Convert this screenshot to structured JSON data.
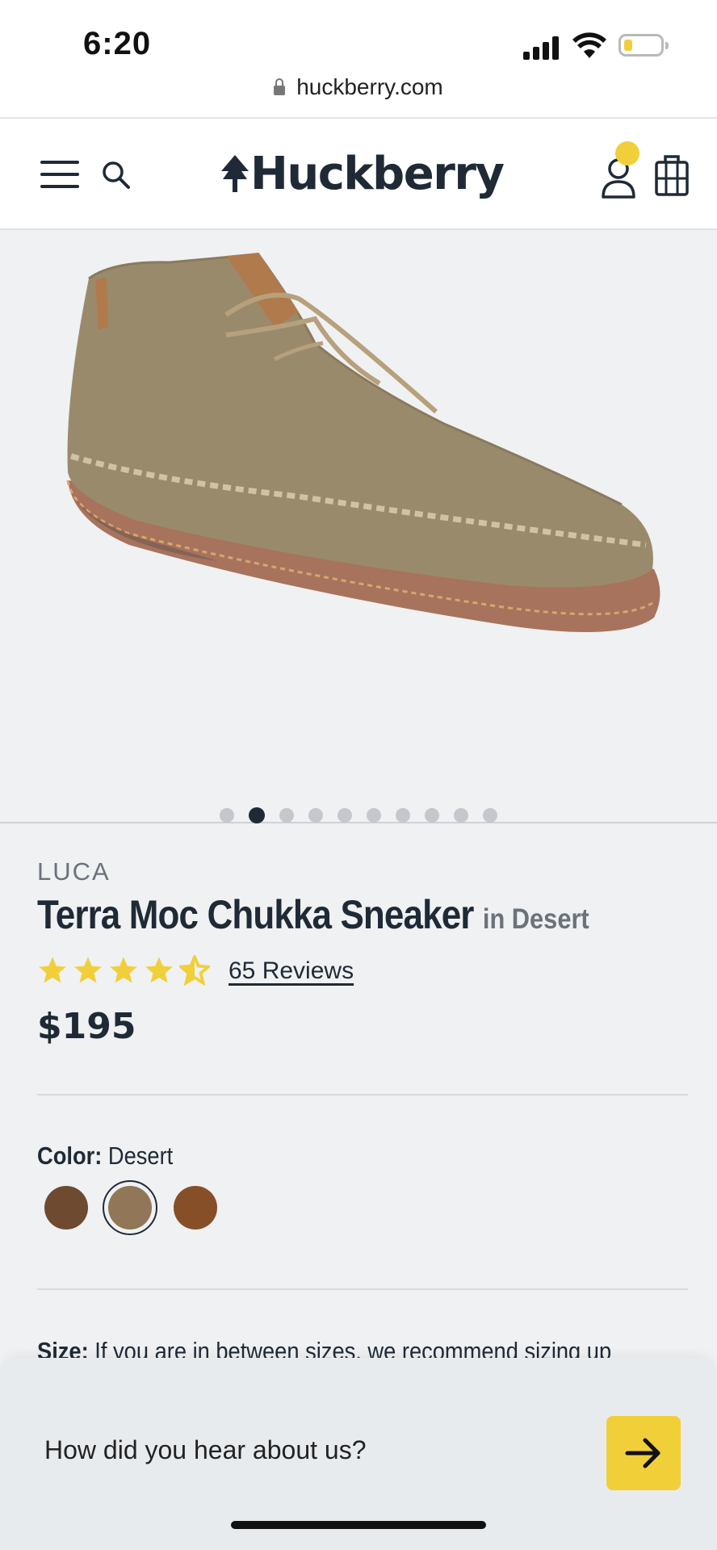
{
  "status_bar": {
    "time": "6:20",
    "url": "huckberry.com"
  },
  "header": {
    "logo": "Huckberry",
    "accent": "#f1cf39"
  },
  "gallery": {
    "image_count": 10,
    "active_index": 1
  },
  "product": {
    "brand": "LUCA",
    "name": "Terra Moc Chukka Sneaker",
    "variant": "in Desert",
    "rating": 4.5,
    "reviews_label": "65 Reviews",
    "price": "$195"
  },
  "color": {
    "label": "Color:",
    "selected": "Desert",
    "swatches": [
      "#6e4a31",
      "#917757",
      "#874f28"
    ]
  },
  "size": {
    "label": "Size:",
    "note": "If you are in between sizes, we recommend sizing up"
  },
  "survey": {
    "question": "How did you hear about us?"
  },
  "icons": [
    "lock-icon",
    "hamburger-icon",
    "search-icon",
    "tree-icon",
    "account-icon",
    "cart-icon",
    "star-icon",
    "arrow-right-icon"
  ]
}
